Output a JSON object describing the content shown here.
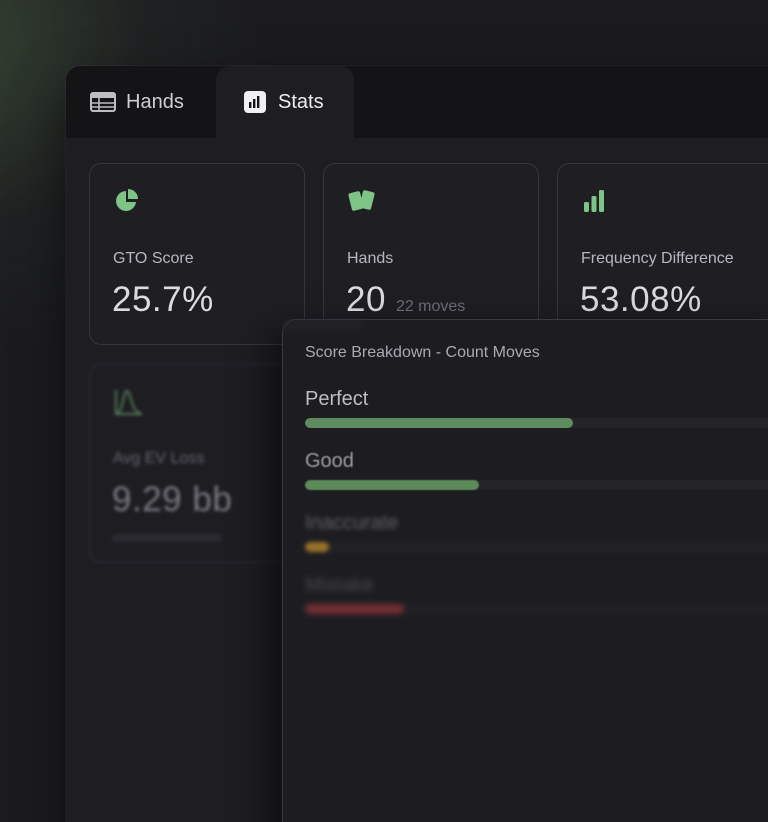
{
  "tabs": [
    {
      "label": "Hands",
      "icon": "table-icon"
    },
    {
      "label": "Stats",
      "icon": "bar-chart-icon",
      "active": true
    }
  ],
  "cards": [
    {
      "icon": "pie-chart-icon",
      "label": "GTO Score",
      "value": "25.7%"
    },
    {
      "icon": "cards-icon",
      "label": "Hands",
      "value": "20",
      "sub": "22 moves"
    },
    {
      "icon": "signal-bars-icon",
      "label": "Frequency Difference",
      "value": "53.08%"
    },
    {
      "icon": "distribution-curve-icon",
      "label": "Avg EV Loss",
      "value": "9.29",
      "unit": "bb"
    }
  ],
  "breakdown": {
    "title": "Score Breakdown - Count Moves",
    "rows": [
      {
        "label": "Perfect",
        "fraction": 0.57,
        "color": "#5e8c5e"
      },
      {
        "label": "Good",
        "fraction": 0.37,
        "color": "#5c8a58"
      },
      {
        "label": "Inaccurate",
        "fraction": 0.05,
        "color": "#b8862d"
      },
      {
        "label": "Mistake",
        "fraction": 0.21,
        "color": "#a2393a"
      }
    ]
  },
  "colors": {
    "accent": "#7ec486",
    "background": "#1b1b1f",
    "panel": "#1d1d22"
  }
}
